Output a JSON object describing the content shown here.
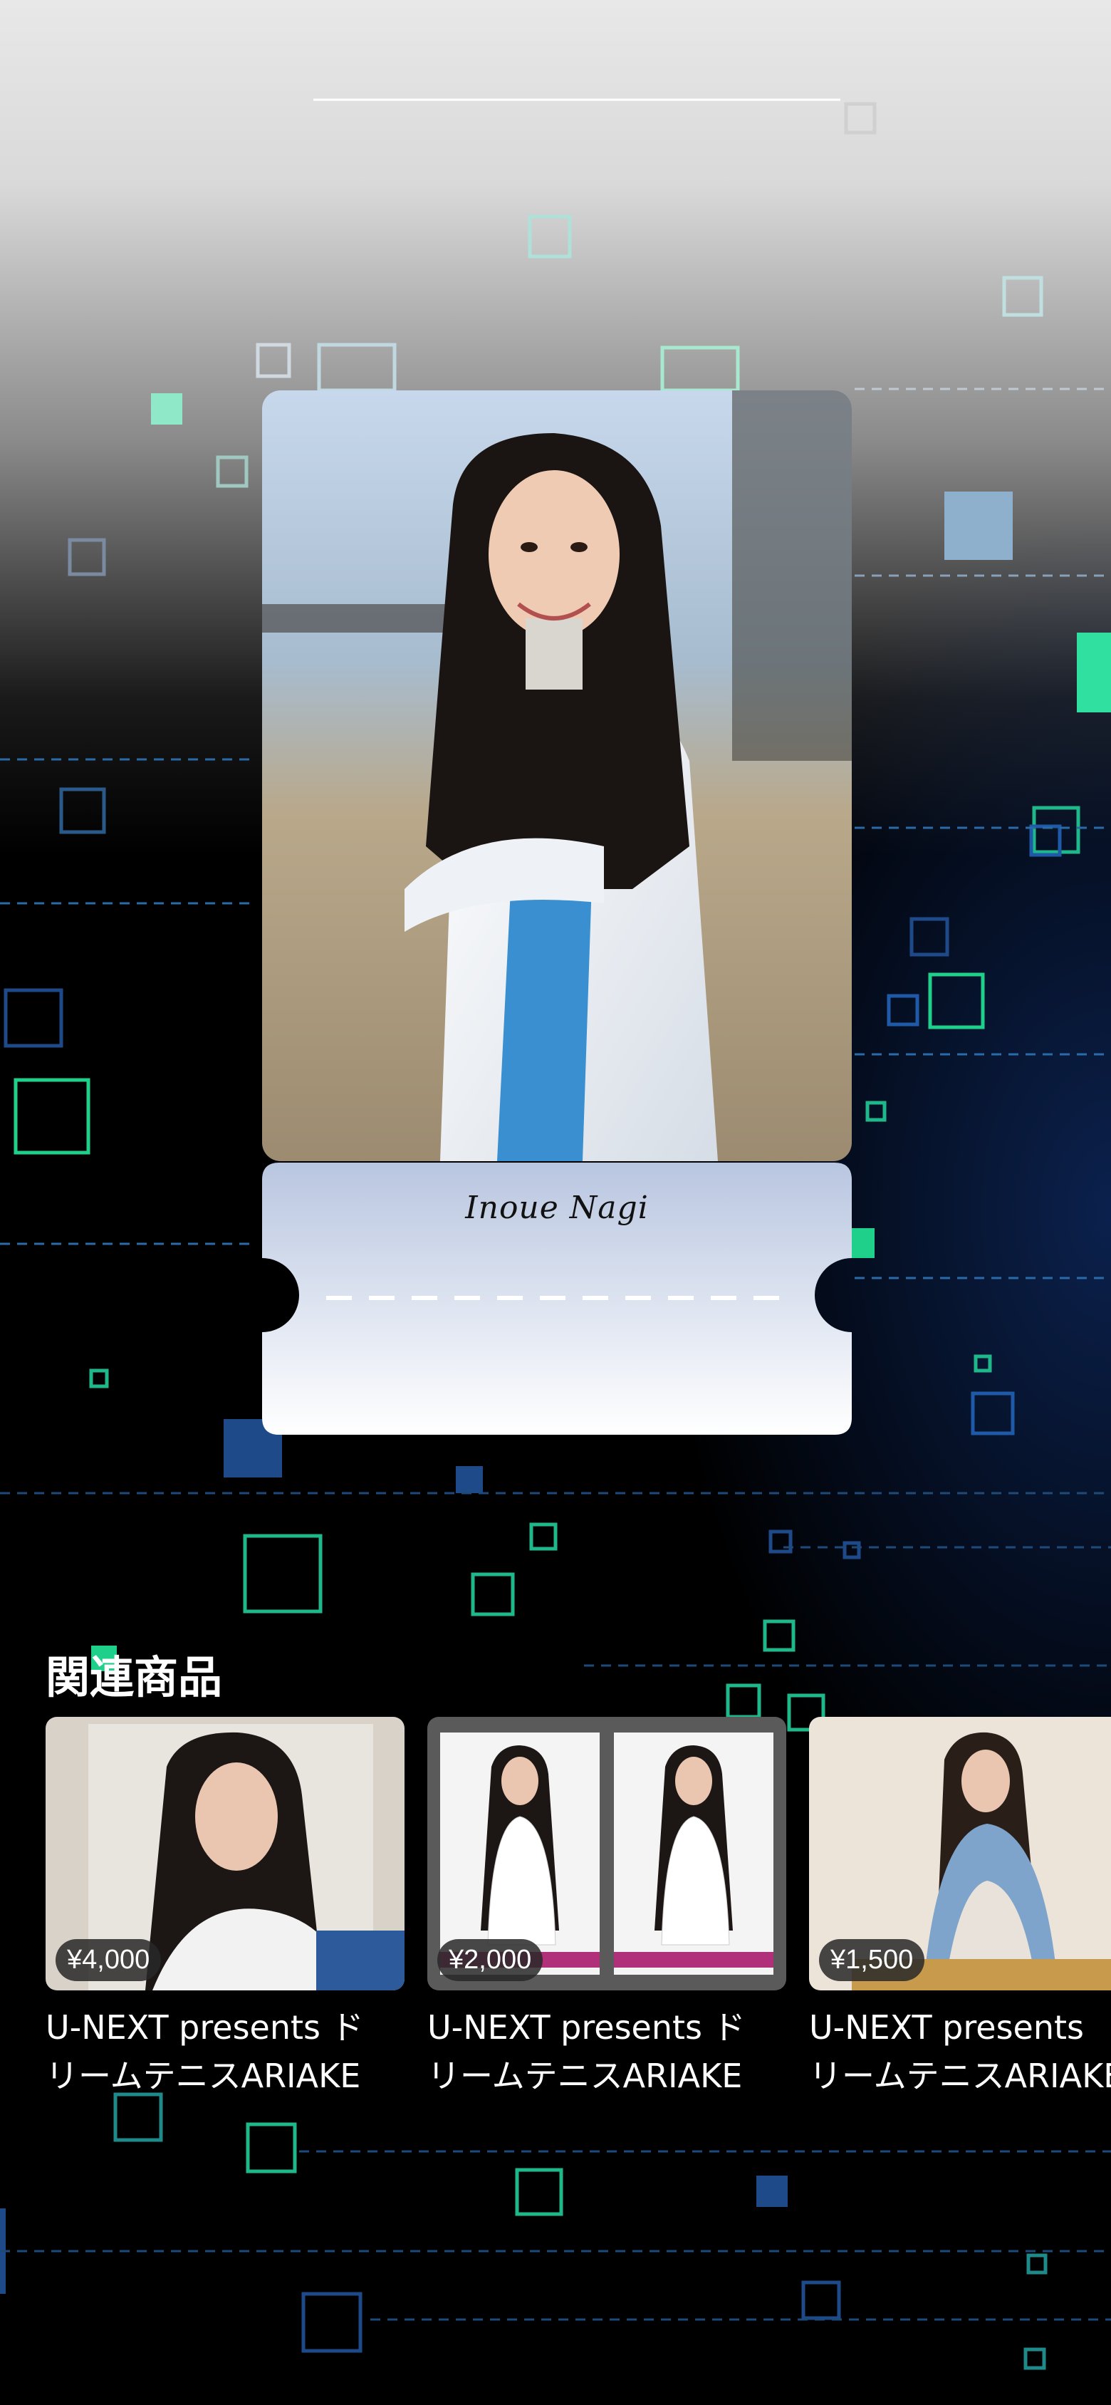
{
  "card": {
    "member_name": "Inoue Nagi"
  },
  "related": {
    "title": "関連商品",
    "items": [
      {
        "price": "¥4,000",
        "title_line1": "U-NEXT presents ド",
        "title_line2": "リームテニスARIAKE"
      },
      {
        "price": "¥2,000",
        "title_line1": "U-NEXT presents ド",
        "title_line2": "リームテニスARIAKE"
      },
      {
        "price": "¥1,500",
        "title_line1": "U-NEXT presents",
        "title_line2": "リームテニスARIAKE"
      }
    ]
  },
  "colors": {
    "accent_green": "#1fd08a",
    "accent_blue": "#1e5aa8",
    "ticket_top": "#b9c6e0",
    "ticket_bottom": "#ffffff"
  }
}
